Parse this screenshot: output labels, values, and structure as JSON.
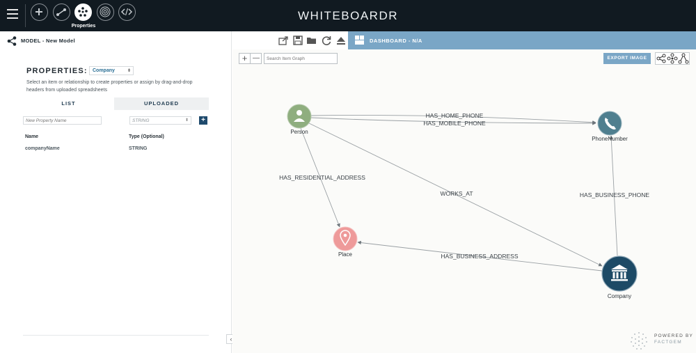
{
  "topbar": {
    "app_title": "WHITEBOARDR",
    "active_tool_label": "Properties",
    "tools": [
      "add-node",
      "add-relationship",
      "properties",
      "fingerprint",
      "code"
    ]
  },
  "left_panel": {
    "model_title": "MODEL - New Model",
    "properties_heading": "PROPERTIES:",
    "selected_type": "Company",
    "help_text": "Select an item or relationship to create properties or assign by drag-and-drop headers from uploaded spreadsheets",
    "tabs": {
      "list": "LIST",
      "uploaded": "UPLOADED"
    },
    "new_property_placeholder": "New Property Name",
    "type_select_value": "STRING",
    "add_button": "+",
    "columns": {
      "name": "Name",
      "type": "Type (Optional)"
    },
    "rows": [
      {
        "name": "companyName",
        "type": "STRING"
      }
    ]
  },
  "dashboard": {
    "title": "DASHBOARD - N/A"
  },
  "canvas": {
    "zoom_in": "+",
    "zoom_out": "—",
    "search_placeholder": "Search Item Graph",
    "export_label": "EXPORT IMAGE",
    "powered_by": "POWERED BY",
    "brand": "FACTGEM"
  },
  "graph": {
    "nodes": [
      {
        "id": "person",
        "label": "Person",
        "color": "#8fae7f",
        "icon": "person-icon"
      },
      {
        "id": "phone",
        "label": "PhoneNumber",
        "color": "#4f7f8f",
        "icon": "phone-icon"
      },
      {
        "id": "place",
        "label": "Place",
        "color": "#ee9a9a",
        "icon": "location-pin-icon"
      },
      {
        "id": "company",
        "label": "Company",
        "color": "#1d4a66",
        "icon": "bank-icon"
      }
    ],
    "edges": [
      {
        "from": "person",
        "to": "phone",
        "label": "HAS_HOME_PHONE"
      },
      {
        "from": "person",
        "to": "phone",
        "label": "HAS_MOBILE_PHONE"
      },
      {
        "from": "person",
        "to": "place",
        "label": "HAS_RESIDENTIAL_ADDRESS"
      },
      {
        "from": "person",
        "to": "company",
        "label": "WORKS_AT"
      },
      {
        "from": "company",
        "to": "phone",
        "label": "HAS_BUSINESS_PHONE"
      },
      {
        "from": "company",
        "to": "place",
        "label": "HAS_BUSINESS_ADDRESS"
      }
    ]
  }
}
